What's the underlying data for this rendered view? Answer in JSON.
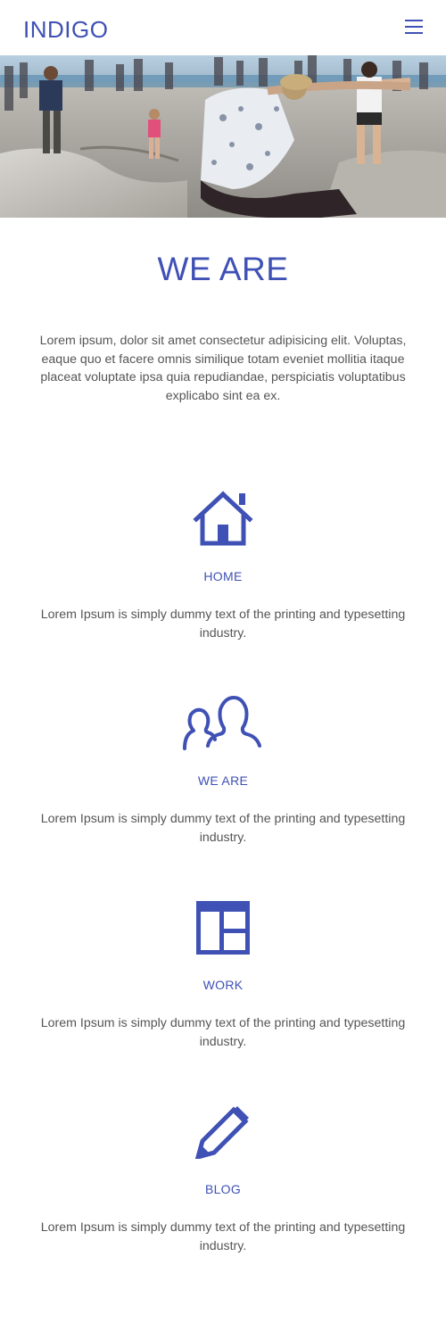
{
  "header": {
    "brand": "INDIGO",
    "menu_icon": "hamburger-menu-icon"
  },
  "hero": {
    "image": "skatepark-photo"
  },
  "about": {
    "title": "WE ARE",
    "text": "Lorem ipsum, dolor sit amet consectetur adipisicing elit. Voluptas, eaque quo et facere omnis similique totam eveniet mollitia itaque placeat voluptate ipsa quia repudiandae, perspiciatis voluptatibus explicabo sint ea ex."
  },
  "features": [
    {
      "icon": "house-icon",
      "label": "HOME",
      "text": "Lorem Ipsum is simply dummy text of the printing and typesetting industry."
    },
    {
      "icon": "people-icon",
      "label": "WE ARE",
      "text": "Lorem Ipsum is simply dummy text of the printing and typesetting industry."
    },
    {
      "icon": "layout-grid-icon",
      "label": "WORK",
      "text": "Lorem Ipsum is simply dummy text of the printing and typesetting industry."
    },
    {
      "icon": "pencil-icon",
      "label": "BLOG",
      "text": "Lorem Ipsum is simply dummy text of the printing and typesetting industry."
    }
  ],
  "colors": {
    "accent": "#3f51b5",
    "text": "#555555",
    "background": "#ffffff"
  }
}
